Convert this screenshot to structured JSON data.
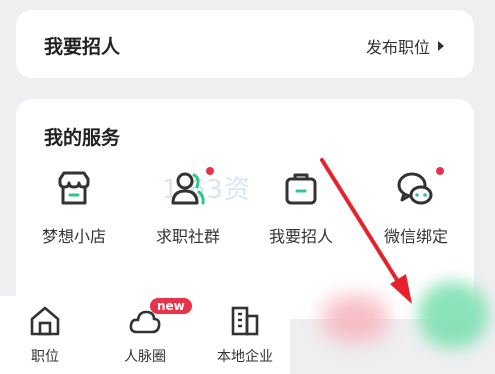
{
  "recruit_card": {
    "title": "我要招人",
    "action_label": "发布职位"
  },
  "services": {
    "title": "我的服务",
    "items": [
      {
        "label": "梦想小店",
        "icon": "shop-icon",
        "has_dot": false
      },
      {
        "label": "求职社群",
        "icon": "people-icon",
        "has_dot": true
      },
      {
        "label": "我要招人",
        "icon": "briefcase-icon",
        "has_dot": false
      },
      {
        "label": "微信绑定",
        "icon": "wechat-icon",
        "has_dot": true
      }
    ]
  },
  "watermark": "1 63资",
  "tabbar": {
    "items": [
      {
        "label": "职位",
        "icon": "home-icon"
      },
      {
        "label": "人脉圈",
        "icon": "cloud-icon",
        "badge": "new"
      },
      {
        "label": "本地企业",
        "icon": "building-icon"
      }
    ]
  },
  "colors": {
    "accent_green": "#2fc88a",
    "dot_red": "#e8334a",
    "arrow_red": "#e8202a"
  }
}
